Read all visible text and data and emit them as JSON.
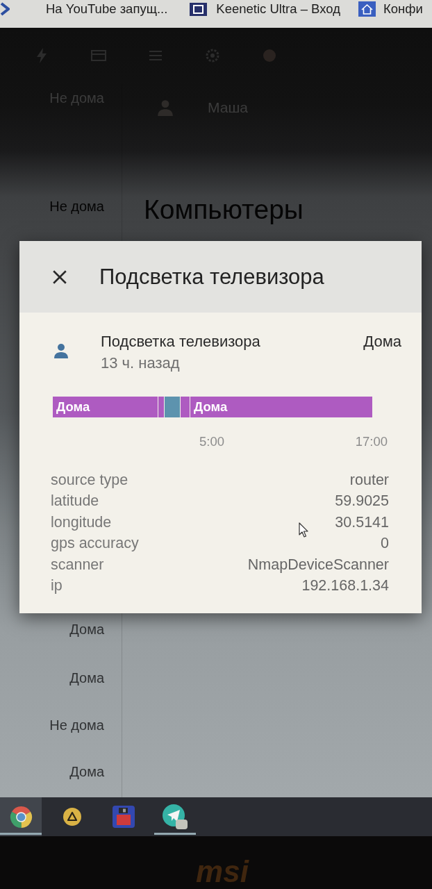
{
  "bookmarks_bar": {
    "items": [
      {
        "kind": "chevron"
      },
      {
        "kind": "text",
        "label": "На YouTube запущ..."
      },
      {
        "kind": "square-logo",
        "label": "Keenetic Ultra – Вход"
      },
      {
        "kind": "house",
        "label": "Конфи"
      }
    ]
  },
  "background_page": {
    "statuses": [
      "Не дома",
      "Не дома",
      "Дома",
      "Дома",
      "Не дома",
      "Дома"
    ],
    "person": {
      "name": "Маша"
    },
    "section_heading": "Компьютеры"
  },
  "dialog": {
    "title": "Подсветка телевизора",
    "entity": {
      "name": "Подсветка телевизора",
      "last_changed": "13 ч. назад",
      "state": "Дома"
    },
    "timeline": {
      "segments": [
        {
          "label": "Дома",
          "color": "#ae5bc1"
        },
        {
          "color": "#ae5bc1"
        },
        {
          "color": "#5d93ae"
        },
        {
          "color": "#ae5bc1"
        },
        {
          "label": "Дома",
          "color": "#ae5bc1"
        }
      ],
      "time_labels": [
        "5:00",
        "17:00"
      ]
    },
    "attributes": [
      {
        "label": "source type",
        "value": "router"
      },
      {
        "label": "latitude",
        "value": "59.9025"
      },
      {
        "label": "longitude",
        "value": "30.5141"
      },
      {
        "label": "gps accuracy",
        "value": "0"
      },
      {
        "label": "scanner",
        "value": "NmapDeviceScanner"
      },
      {
        "label": "ip",
        "value": "192.168.1.34"
      }
    ]
  },
  "taskbar": {
    "apps": [
      {
        "kind": "ring",
        "selected": true,
        "running": true
      },
      {
        "kind": "triangle",
        "selected": false,
        "running": false
      },
      {
        "kind": "floppy",
        "selected": false,
        "running": false
      },
      {
        "kind": "plane",
        "selected": false,
        "running": true
      }
    ]
  },
  "bezel": {
    "logo": "msi"
  }
}
